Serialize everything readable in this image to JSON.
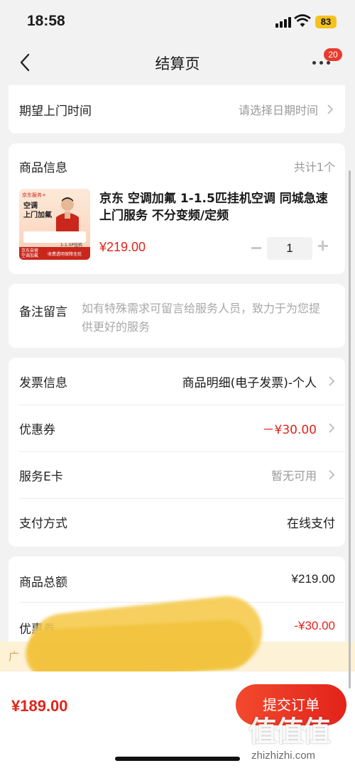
{
  "status_bar": {
    "time": "18:58",
    "battery": "83"
  },
  "nav": {
    "title": "结算页",
    "badge_count": "20"
  },
  "visit_time": {
    "label": "期望上门时间",
    "placeholder": "请选择日期时间"
  },
  "product_section": {
    "title": "商品信息",
    "count_text": "共计1个",
    "product": {
      "name": "京东 空调加氟 1-1.5匹挂机空调 同城急速上门服务 不分变频/定频",
      "price": "¥219.00",
      "quantity": "1",
      "thumb": {
        "brand_line": "京东服务+",
        "headline": "空调\n上门加氟",
        "bar_left": "京东自营\n空调加氟",
        "bar_right": "收费透明保障无忧",
        "tag": "1-1.5P挂机"
      }
    }
  },
  "remark": {
    "label": "备注留言",
    "placeholder": "如有特殊需求可留言给服务人员，致力于为您提供更好的服务"
  },
  "info_rows": [
    {
      "label": "发票信息",
      "value": "商品明细(电子发票)-个人",
      "value_style": "dark",
      "chevron": true
    },
    {
      "label": "优惠券",
      "value": "－¥30.00",
      "value_style": "red",
      "chevron": true
    },
    {
      "label": "服务E卡",
      "value": "暂无可用",
      "value_style": "gray",
      "chevron": true
    },
    {
      "label": "支付方式",
      "value": "在线支付",
      "value_style": "dark",
      "chevron": false
    }
  ],
  "summary": {
    "goods_total_label": "商品总额",
    "goods_total_value": "¥219.00",
    "coupon_label": "优惠券",
    "coupon_value": "-¥30.00"
  },
  "promo_banner": {
    "text": "广"
  },
  "bottom_bar": {
    "total": "¥189.00",
    "submit_label": "提交订单"
  },
  "watermark": {
    "logo": "值值值",
    "site": "zhizhizhi.com"
  },
  "colors": {
    "accent_red": "#e2231a",
    "highlight_yellow": "#f5c94a"
  }
}
